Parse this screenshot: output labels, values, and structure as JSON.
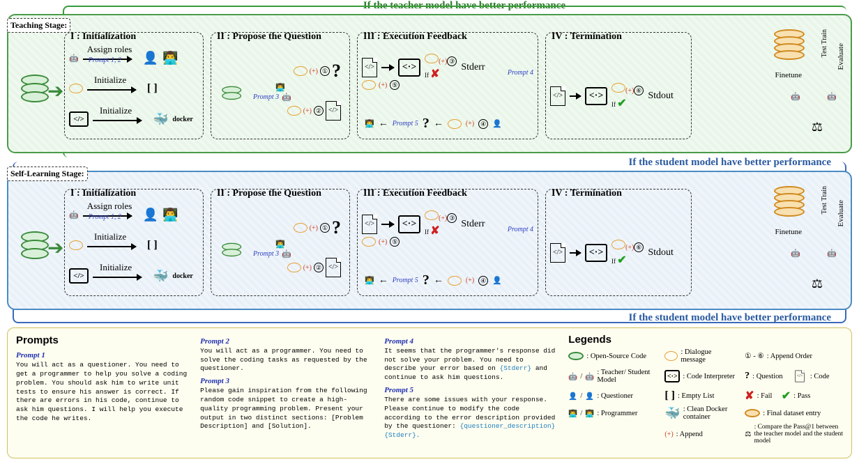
{
  "banners": {
    "top": "If the teacher model have better performance",
    "mid_student1": "If the student model have better performance",
    "mid_student2": "If the student model have better performance"
  },
  "stages": {
    "teaching": "Teaching Stage:",
    "self": "Self-Learning Stage:"
  },
  "phases": {
    "p1": "I : Initialization",
    "p2": "II : Propose the Question",
    "p3": "III : Execution Feedback",
    "p4": "IV : Termination"
  },
  "phase1": {
    "assign": "Assign roles",
    "init": "Initialize",
    "prompt12": "Prompt 1, 2",
    "docker": "docker"
  },
  "phase2": {
    "prompt3": "Prompt 3",
    "plus": "(+)",
    "n1": "①",
    "n2": "②"
  },
  "phase3": {
    "stderr": "Stderr",
    "if": "If",
    "prompt4": "Prompt 4",
    "prompt5": "Prompt 5",
    "n3": "③",
    "n4": "④",
    "n5": "⑤"
  },
  "phase4": {
    "stdout": "Stdout",
    "if": "If",
    "n6": "⑥"
  },
  "final": {
    "test": "Test",
    "train": "Train",
    "evaluate": "Evaluate",
    "finetune": "Finetune"
  },
  "prompts": {
    "title": "Prompts",
    "p1": {
      "h": "Prompt 1",
      "b": "You will act as a questioner. You need to get a programmer to help you solve a coding problem. You should ask him to write unit tests to ensure his answer is correct. If there are errors in his code, continue to ask him questions. I will help you execute the code he writes."
    },
    "p2": {
      "h": "Prompt 2",
      "b": "You will act as a programmer. You need to solve the coding tasks as requested by the questioner."
    },
    "p3": {
      "h": "Prompt 3",
      "b": "Please gain inspiration from the following random code snippet to create a high-quality programming problem. Present your output in two distinct sections: [Problem Description] and [Solution]."
    },
    "p4": {
      "h": "Prompt 4",
      "b1": "It seems that the programmer's response did not solve your problem. You need to describe your error based on ",
      "tok": "{Stderr}",
      "b2": " and continue to ask him questions."
    },
    "p5": {
      "h": "Prompt 5",
      "b1": "There are some issues with your response. Please continue to modify the code according to the error description provided by the questioner: ",
      "tok": "{questioner_description} {Stderr}."
    }
  },
  "legends": {
    "title": "Legends",
    "open_source": ": Open-Source Code",
    "teacher_student": ": Teacher/ Student Model",
    "questioner": ": Questioner",
    "programmer": ": Programmer",
    "dialogue": ": Dialogue message",
    "code_interp": ": Code Interpreter",
    "empty_list": ": Empty List",
    "docker": ": Clean Docker container",
    "append": ": Append",
    "append_order": ": Append Order",
    "order_range": "① - ⑥",
    "question": ": Question",
    "code": ": Code",
    "fail": ": Fail",
    "pass": ": Pass",
    "final_ds": ": Final dataset entry",
    "compare": ": Compare the Pass@1 between the teacher model and the student model"
  }
}
